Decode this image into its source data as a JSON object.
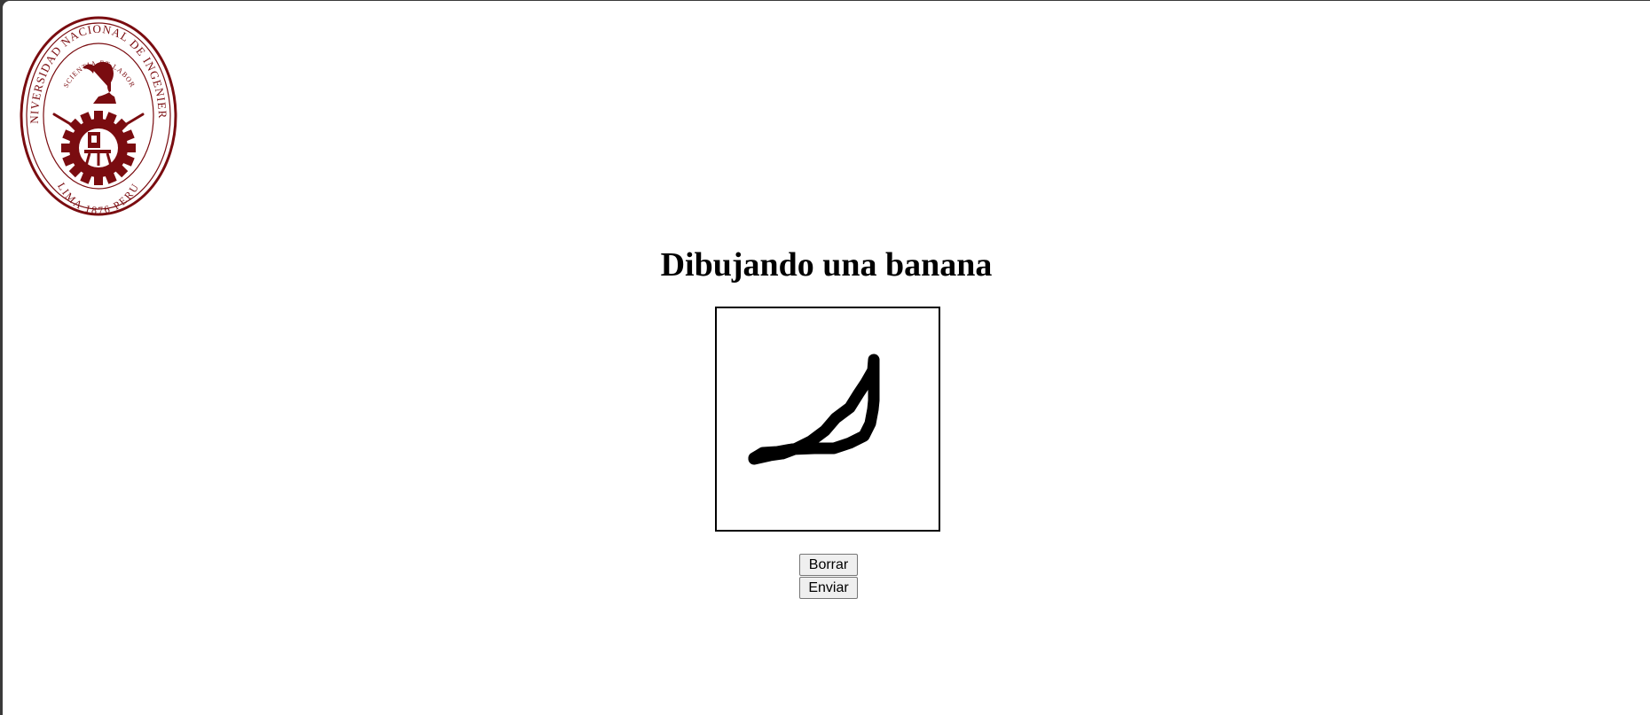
{
  "logo": {
    "name": "uni-seal-logo",
    "ring_text": "UNIVERSIDAD NACIONAL DE INGENIERIA",
    "motto": "SCIENTIA ET LABOR",
    "footer_text": "LIMA 1876 PERU",
    "color": "#7a0c10"
  },
  "page": {
    "title": "Dibujando una banana"
  },
  "canvas": {
    "stroke_color": "#000000"
  },
  "buttons": {
    "clear_label": "Borrar",
    "submit_label": "Enviar"
  }
}
